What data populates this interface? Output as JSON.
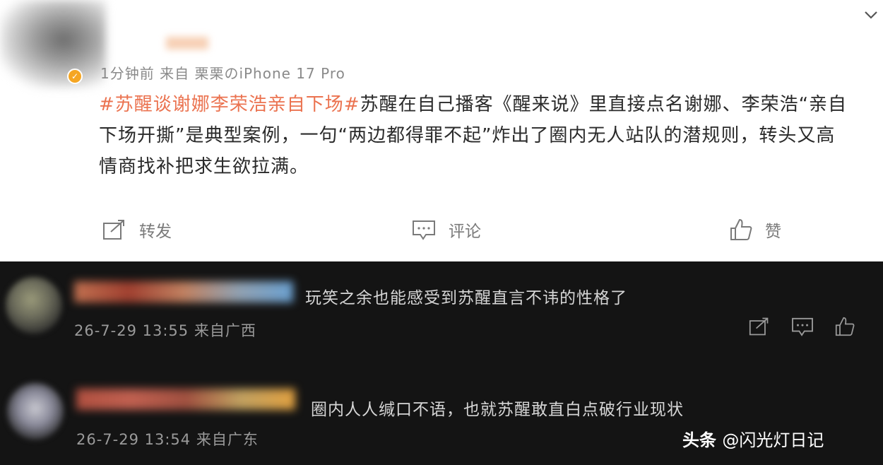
{
  "post": {
    "meta": "1分钟前  来自 栗栗のiPhone 17 Pro",
    "hashtag": "#苏醒谈谢娜李荣浩亲自下场#",
    "text_line1": "苏醒在自己播客《醒来说》里直接点名谢娜、李荣浩“亲自",
    "text_line2": "下场开撕”是典型案例，一句“两边都得罪不起”炸出了圈内无人站队的潜规则，转头又高",
    "text_line3": "情商找补把求生欲拉满。",
    "actions": {
      "repost": "转发",
      "comment": "评论",
      "like": "赞"
    }
  },
  "comments": [
    {
      "text": "玩笑之余也能感受到苏醒直言不讳的性格了",
      "meta": "26-7-29 13:55 来自广西"
    },
    {
      "text": "圈内人人缄口不语，也就苏醒敢直白点破行业现状",
      "meta": "26-7-29 13:54 来自广东"
    }
  ],
  "watermark": {
    "brand": "头条",
    "handle": "@闪光灯日记"
  },
  "colors": {
    "accent_tag": "#eb7350",
    "verified_badge": "#f5a623",
    "dark_bg": "#141414"
  }
}
